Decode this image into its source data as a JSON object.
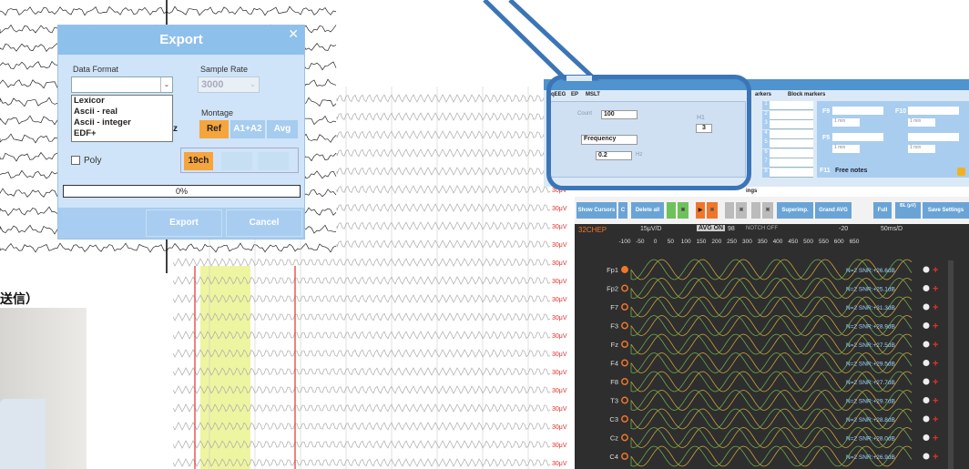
{
  "export_dialog": {
    "title": "Export",
    "data_format_label": "Data Format",
    "sample_rate_label": "Sample Rate",
    "sample_rate_value": "3000",
    "format_options": [
      "Lexicor",
      "Ascii - real",
      "Ascii - integer",
      "EDF+"
    ],
    "montage_label": "Montage",
    "montage_options": [
      "Ref",
      "A1+A2",
      "Avg"
    ],
    "montage_selected": "Ref",
    "poly_label": "Poly",
    "channels_label": "19ch",
    "progress_text": "0%",
    "export_button": "Export",
    "cancel_button": "Cancel",
    "partial_z": "z"
  },
  "amplitude_label": "30μV",
  "qeeg_panel": {
    "tabs": [
      "qEEG",
      "EP",
      "MSLT"
    ],
    "count_label": "Count",
    "count_value": "100",
    "mode_value": "Frequency",
    "freq_value": "0.2",
    "freq_unit": "Hz",
    "h1_label": "H1",
    "h1_value": "3",
    "marker_tabs": [
      "arkers",
      "Block markers"
    ],
    "f_labels": [
      "F9",
      "F10",
      "F5",
      "F11"
    ],
    "f11_text": "Free notes",
    "min_label": "1 min",
    "row_numbers": [
      "1",
      "2",
      "3",
      "4",
      "5",
      "6",
      "7",
      "8"
    ]
  },
  "toolbar": {
    "show_cursors": "Show Cursors",
    "c": "C",
    "delete_all": "Delete all",
    "superimp": "Superimp.",
    "grand_avg": "Grand AVG",
    "full": "Full",
    "save_settings": "Save Settings",
    "ings": "ings",
    "bl_label": "BL (μV)"
  },
  "eeg_panel": {
    "montage_name": "32CHEP",
    "scale": "15μV/D",
    "avg_on": "AVG ON",
    "avg_count": "98",
    "notch": "NOTCH OFF",
    "time_scale": "50ms/D",
    "offset": "-20",
    "x_ticks": [
      "-100",
      "-50",
      "0",
      "50",
      "100",
      "150",
      "200",
      "250",
      "300",
      "350",
      "400",
      "450",
      "500",
      "550",
      "600",
      "650"
    ],
    "channels": [
      {
        "name": "Fp1",
        "snr": "N=2  SNR:+26.6dB"
      },
      {
        "name": "Fp2",
        "snr": "N=2  SNR:+25.1dB"
      },
      {
        "name": "F7",
        "snr": "N=2  SNR:+31.3dB"
      },
      {
        "name": "F3",
        "snr": "N=2  SNR:+28.9dB"
      },
      {
        "name": "Fz",
        "snr": "N=2  SNR:+27.5dB"
      },
      {
        "name": "F4",
        "snr": "N=2  SNR:+29.5dB"
      },
      {
        "name": "F8",
        "snr": "N=2  SNR:+27.7dB"
      },
      {
        "name": "T3",
        "snr": "N=2  SNR:+29.7dB"
      },
      {
        "name": "C3",
        "snr": "N=2  SNR:+28.8dB"
      },
      {
        "name": "Cz",
        "snr": "N=2  SNR:+28.0dB"
      },
      {
        "name": "C4",
        "snr": "N=2  SNR:+26.9dB"
      }
    ]
  },
  "japanese_text": "送信）",
  "colors": {
    "accent_orange": "#f6a53c",
    "dialog_blue": "#8ec0ec",
    "callout_blue": "#3c75b6",
    "highlight_yellow": "#eef5a0"
  }
}
